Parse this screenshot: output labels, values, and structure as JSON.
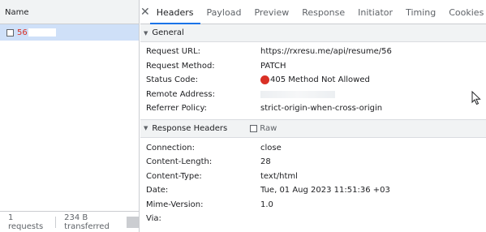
{
  "request_list": {
    "header": "Name",
    "selected_request": "56",
    "footer": {
      "requests": "1 requests",
      "transferred": "234 B transferred"
    }
  },
  "tabs": [
    {
      "label": "Headers",
      "active": true
    },
    {
      "label": "Payload"
    },
    {
      "label": "Preview"
    },
    {
      "label": "Response"
    },
    {
      "label": "Initiator"
    },
    {
      "label": "Timing"
    },
    {
      "label": "Cookies"
    }
  ],
  "general": {
    "title": "General",
    "rows": [
      {
        "key": "Request URL:",
        "value": "https://rxresu.me/api/resume/56"
      },
      {
        "key": "Request Method:",
        "value": "PATCH"
      },
      {
        "key": "Status Code:",
        "value": "405 Method Not Allowed"
      },
      {
        "key": "Remote Address:",
        "value": ""
      },
      {
        "key": "Referrer Policy:",
        "value": "strict-origin-when-cross-origin"
      }
    ]
  },
  "response_headers": {
    "title": "Response Headers",
    "raw_label": "Raw",
    "rows": [
      {
        "key": "Connection:",
        "value": "close"
      },
      {
        "key": "Content-Length:",
        "value": "28"
      },
      {
        "key": "Content-Type:",
        "value": "text/html"
      },
      {
        "key": "Date:",
        "value": "Tue, 01 Aug 2023 11:51:36 +03"
      },
      {
        "key": "Mime-Version:",
        "value": "1.0"
      },
      {
        "key": "Via:",
        "value": ""
      }
    ]
  },
  "colors": {
    "status_error": "#d93025",
    "selected_row": "#cfe0f8",
    "active_tab": "#1a73e8"
  }
}
